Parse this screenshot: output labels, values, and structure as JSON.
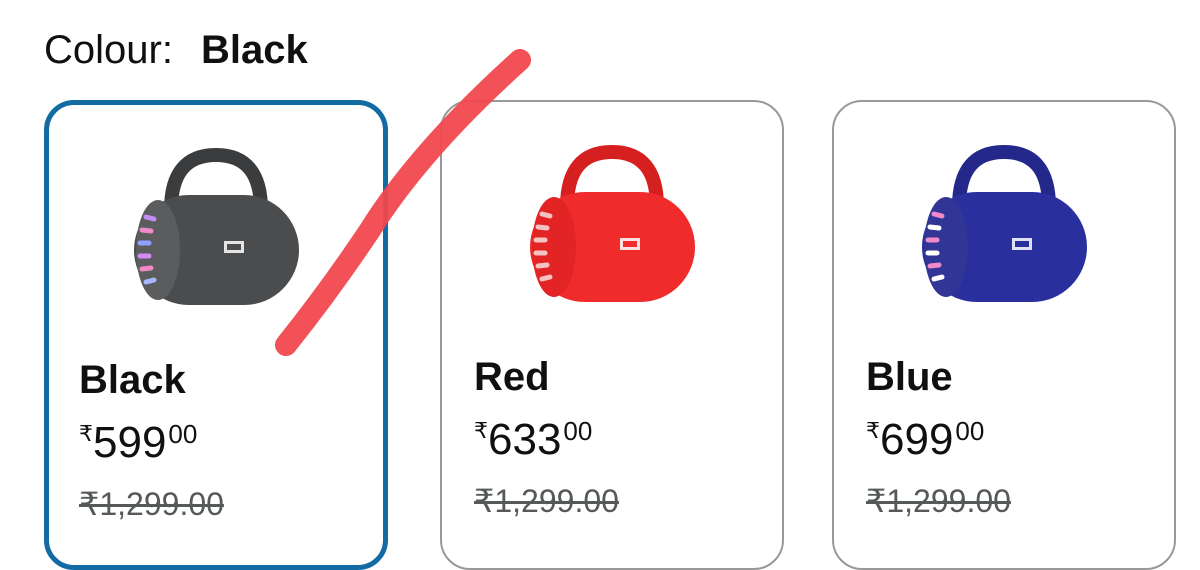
{
  "colour": {
    "label": "Colour:",
    "value": "Black"
  },
  "variants": [
    {
      "name": "Black",
      "currency": "₹",
      "price_whole": "599",
      "price_fraction": "00",
      "mrp": "₹1,299.00",
      "body_color": "#4a4c4e",
      "handle_color": "#3a3c3e",
      "selected": true
    },
    {
      "name": "Red",
      "currency": "₹",
      "price_whole": "633",
      "price_fraction": "00",
      "mrp": "₹1,299.00",
      "body_color": "#ef2b2b",
      "handle_color": "#d61f1f",
      "selected": false
    },
    {
      "name": "Blue",
      "currency": "₹",
      "price_whole": "699",
      "price_fraction": "00",
      "mrp": "₹1,299.00",
      "body_color": "#2a2f9e",
      "handle_color": "#23288a",
      "selected": false
    }
  ],
  "colors": {
    "selected_border": "#136ba4",
    "card_border": "#999999",
    "annotation_stroke": "#f0484e"
  },
  "icons": {
    "speaker": "speaker-image"
  }
}
